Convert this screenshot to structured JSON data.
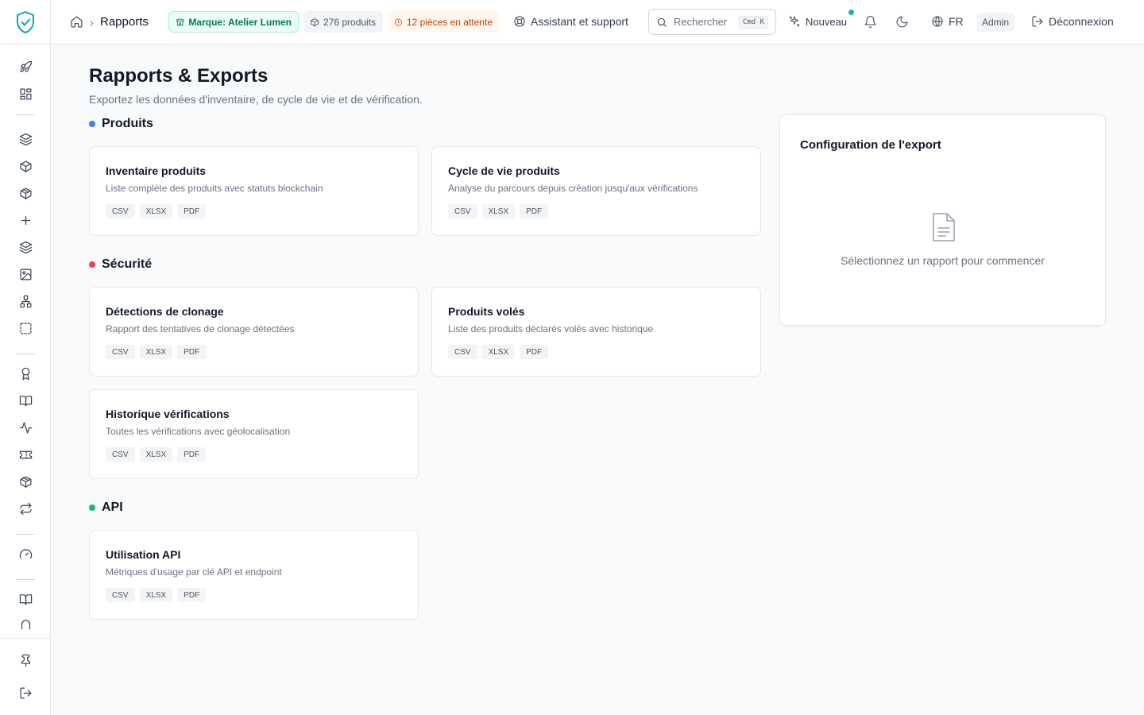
{
  "topbar": {
    "breadcrumb_current": "Rapports",
    "brand_pill": "Marque: Atelier Lumen",
    "products_pill": "276 produits",
    "pending_pill": "12 pièces en attente",
    "support_link": "Assistant et support",
    "search_placeholder": "Rechercher",
    "search_shortcut": "Cmd K",
    "new_label": "Nouveau",
    "language": "FR",
    "role_badge": "Admin",
    "logout_label": "Déconnexion"
  },
  "page": {
    "title": "Rapports & Exports",
    "subtitle": "Exportez les données d'inventaire, de cycle de vie et de vérification."
  },
  "sections": [
    {
      "label": "Produits",
      "color": "#3b82f6",
      "reports": [
        {
          "title": "Inventaire produits",
          "desc": "Liste complète des produits avec statuts blockchain",
          "formats": [
            "CSV",
            "XLSX",
            "PDF"
          ]
        },
        {
          "title": "Cycle de vie produits",
          "desc": "Analyse du parcours depuis création jusqu'aux vérifications",
          "formats": [
            "CSV",
            "XLSX",
            "PDF"
          ]
        }
      ]
    },
    {
      "label": "Sécurité",
      "color": "#ef4444",
      "reports": [
        {
          "title": "Détections de clonage",
          "desc": "Rapport des tentatives de clonage détectées",
          "formats": [
            "CSV",
            "XLSX",
            "PDF"
          ]
        },
        {
          "title": "Produits volés",
          "desc": "Liste des produits déclarés volés avec historique",
          "formats": [
            "CSV",
            "XLSX",
            "PDF"
          ]
        },
        {
          "title": "Historique vérifications",
          "desc": "Toutes les vérifications avec géolocalisation",
          "formats": [
            "CSV",
            "XLSX",
            "PDF"
          ]
        }
      ]
    },
    {
      "label": "API",
      "color": "#10b981",
      "reports": [
        {
          "title": "Utilisation API",
          "desc": "Métriques d'usage par clé API et endpoint",
          "formats": [
            "CSV",
            "XLSX",
            "PDF"
          ]
        }
      ]
    }
  ],
  "config": {
    "title": "Configuration de l'export",
    "empty_text": "Sélectionnez un rapport pour commencer"
  },
  "icons": {
    "sidebar": [
      "rocket-icon",
      "dashboard-icon",
      "layers-icon",
      "box-icon",
      "package-icon",
      "plus-icon",
      "layers-icon",
      "image-icon",
      "network-icon",
      "selection-icon",
      "award-icon",
      "book-icon",
      "activity-icon",
      "ticket-icon",
      "package-icon",
      "repeat-icon",
      "gauge-icon",
      "book-icon",
      "arch-icon",
      "pin-icon",
      "logout-icon"
    ]
  }
}
